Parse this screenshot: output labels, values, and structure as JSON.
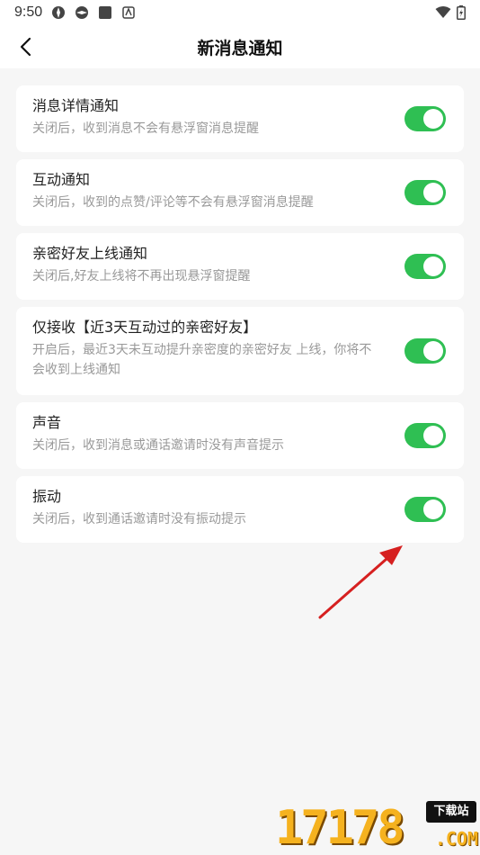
{
  "status_bar": {
    "time": "9:50"
  },
  "header": {
    "title": "新消息通知"
  },
  "settings": [
    {
      "label": "消息详情通知",
      "desc": "关闭后，收到消息不会有悬浮窗消息提醒",
      "enabled": true
    },
    {
      "label": "互动通知",
      "desc": "关闭后，收到的点赞/评论等不会有悬浮窗消息提醒",
      "enabled": true
    },
    {
      "label": "亲密好友上线通知",
      "desc": "关闭后,好友上线将不再出现悬浮窗提醒",
      "enabled": true
    },
    {
      "label": "仅接收【近3天互动过的亲密好友】",
      "desc": "开启后，最近3天未互动提升亲密度的亲密好友 上线，你将不会收到上线通知",
      "enabled": true
    },
    {
      "label": "声音",
      "desc": "关闭后，收到消息或通话邀请时没有声音提示",
      "enabled": true
    },
    {
      "label": "振动",
      "desc": "关闭后，收到通话邀请时没有振动提示",
      "enabled": true
    }
  ],
  "watermark": {
    "digits": "17178",
    "tag": "下载站",
    "com": ".COM"
  },
  "colors": {
    "toggle_on": "#2fbf53",
    "arrow": "#d62020",
    "background": "#f6f6f6"
  }
}
